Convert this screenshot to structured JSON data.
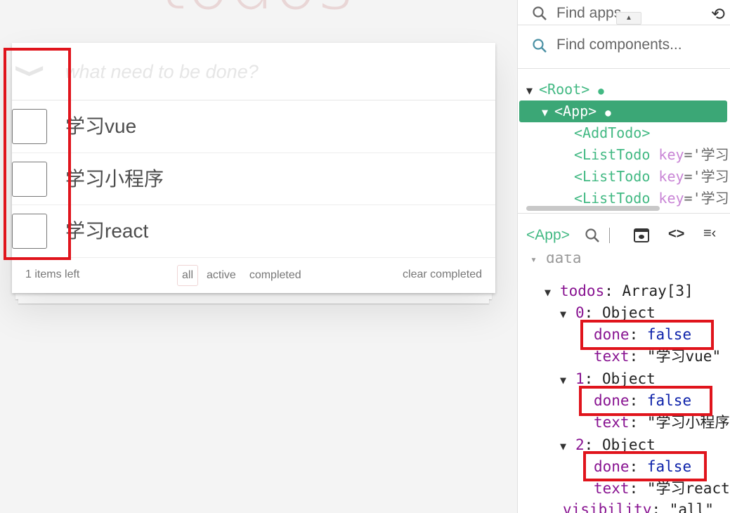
{
  "todo_app": {
    "brand": "todos",
    "new_todo_placeholder": "what need to be done?",
    "toggle_all_icon": "chevron-down-icon",
    "items": [
      {
        "label": "学习vue",
        "done": false
      },
      {
        "label": "学习小程序",
        "done": false
      },
      {
        "label": "学习react",
        "done": false
      }
    ],
    "footer": {
      "count": "1 items left",
      "filters": [
        "all",
        "active",
        "completed"
      ],
      "selected_filter": "all",
      "clear_label": "clear completed"
    }
  },
  "devtools": {
    "find_apps_placeholder": "Find apps...",
    "find_components_placeholder": "Find components...",
    "tree": [
      {
        "name": "<Root>",
        "expanded": true
      },
      {
        "name": "<App>",
        "expanded": true,
        "selected": true
      },
      {
        "name": "<AddTodo>"
      },
      {
        "name": "<ListTodo",
        "key_label": "key",
        "key_value": "='学习"
      },
      {
        "name": "<ListTodo",
        "key_label": "key",
        "key_value": "='学习"
      },
      {
        "name": "<ListTodo",
        "key_label": "key",
        "key_value": "='学习"
      }
    ],
    "selected_component": "<App>",
    "section_title": "data",
    "state": {
      "todos_key": "todos",
      "todos_type": "Array[3]",
      "items": [
        {
          "index": "0",
          "type": "Object",
          "done_key": "done",
          "done_value": "false",
          "text_key": "text",
          "text_value": "\"学习vue\""
        },
        {
          "index": "1",
          "type": "Object",
          "done_key": "done",
          "done_value": "false",
          "text_key": "text",
          "text_value": "\"学习小程序"
        },
        {
          "index": "2",
          "type": "Object",
          "done_key": "done",
          "done_value": "false",
          "text_key": "text",
          "text_value": "\"学习react"
        }
      ],
      "visibility_key": "visibility",
      "visibility_value": "\"all\""
    }
  },
  "colors": {
    "vue_green": "#42b983",
    "selected_row": "#3ba776",
    "annotation_red": "#e0141c",
    "brand_pink": "#af2f2f"
  }
}
